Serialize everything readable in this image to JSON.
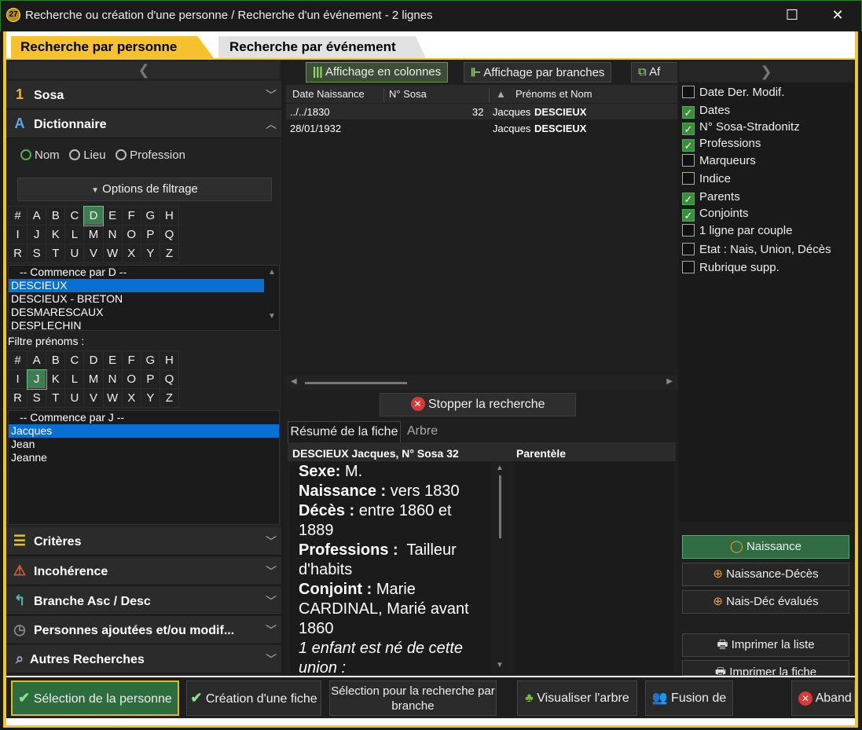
{
  "window": {
    "title": "Recherche ou création d'une personne / Recherche d'un événement - 2 lignes",
    "logo": "27",
    "maximize_glyph": "☐",
    "close_glyph": "✕"
  },
  "tabs": {
    "person": "Recherche par personne",
    "event": "Recherche par événement"
  },
  "left": {
    "sosa": "Sosa",
    "dictionnaire": "Dictionnaire",
    "radios": {
      "nom": "Nom",
      "lieu": "Lieu",
      "profession": "Profession"
    },
    "filter_options": "Options de filtrage",
    "alphabet_rows": [
      [
        "#",
        "A",
        "B",
        "C",
        "D",
        "E",
        "F",
        "G",
        "H"
      ],
      [
        "I",
        "J",
        "K",
        "L",
        "M",
        "N",
        "O",
        "P",
        "Q"
      ],
      [
        "R",
        "S",
        "T",
        "U",
        "V",
        "W",
        "X",
        "Y",
        "Z"
      ]
    ],
    "names_header": "-- Commence par D --",
    "names": [
      "DESCIEUX",
      "DESCIEUX - BRETON",
      "DESMARESCAUX",
      "DESPLECHIN"
    ],
    "firstname_filter_label": "Filtre prénoms :",
    "firstnames_header": "-- Commence par J --",
    "firstnames": [
      "Jacques",
      "Jean",
      "Jeanne"
    ],
    "criteres": "Critères",
    "incoherence": "Incohérence",
    "branche": "Branche Asc / Desc",
    "ajoutees": "Personnes ajoutées et/ou modif...",
    "autres": "Autres Recherches",
    "selected_letter": "D",
    "selected_firstname_letter": "J"
  },
  "toolbar": {
    "columns": "Affichage en colonnes",
    "branches": "Affichage par branches",
    "third": "Af"
  },
  "grid": {
    "headers": {
      "date": "Date Naissance",
      "sosa": "N° Sosa",
      "name": "Prénoms et Nom"
    },
    "rows": [
      {
        "date": "../../1830",
        "sosa": "32",
        "first": "Jacques",
        "last": "DESCIEUX"
      },
      {
        "date": "28/01/1932",
        "sosa": "",
        "first": "Jacques",
        "last": "DESCIEUX"
      }
    ]
  },
  "stop_button": "Stopper la recherche",
  "detail": {
    "tab_summary": "Résumé de la fiche",
    "tab_tree": "Arbre",
    "header": "DESCIEUX Jacques, N° Sosa 32",
    "parentele": "Parentèle",
    "sexe_label": "Sexe:",
    "sexe_value": "M.",
    "naissance_label": "Naissance :",
    "naissance_value": "vers 1830",
    "deces_label": "Décès :",
    "deces_value": "entre 1860 et 1889",
    "professions_label": "Professions :",
    "professions_value": "Tailleur d'habits",
    "conjoint_label": "Conjoint :",
    "conjoint_value": "Marie CARDINAL, Marié avant 1860",
    "enfant_text": "1 enfant est né de cette union :"
  },
  "options": [
    {
      "label": "Date Der. Modif.",
      "checked": false
    },
    {
      "label": "Dates",
      "checked": true
    },
    {
      "label": "N° Sosa-Stradonitz",
      "checked": true
    },
    {
      "label": "Professions",
      "checked": true
    },
    {
      "label": "Marqueurs",
      "checked": false
    },
    {
      "label": "Indice",
      "checked": false
    },
    {
      "label": "Parents",
      "checked": true
    },
    {
      "label": "Conjoints",
      "checked": true
    },
    {
      "label": "1 ligne par couple",
      "checked": false
    },
    {
      "label": "Etat : Nais, Union, Décès",
      "checked": false
    },
    {
      "label": "Rubrique supp.",
      "checked": false
    }
  ],
  "right_buttons": {
    "naissance": "Naissance",
    "naissance_deces": "Naissance-Décès",
    "nais_dec_evalues": "Nais-Déc évalués",
    "print_list": "Imprimer la liste",
    "print_card": "Imprimer la fiche"
  },
  "bottom": {
    "select_person": "Sélection de la personne",
    "create_card": "Création d'une fiche",
    "select_branch": "Sélection pour la recherche par branche",
    "view_tree": "Visualiser l'arbre",
    "merge": "Fusion de",
    "cancel": "Aband"
  },
  "colors": {
    "accent_gold": "#f0c62b",
    "accent_green": "#3e7d52",
    "selection_blue": "#0a6fd0"
  }
}
